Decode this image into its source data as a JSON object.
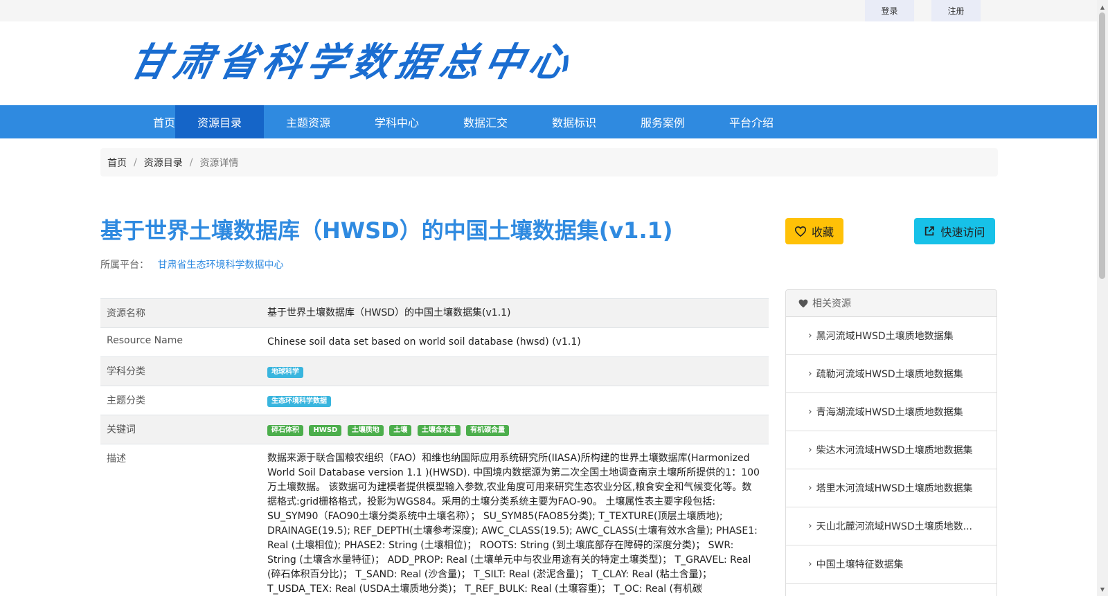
{
  "topbar": {
    "login_label": "登录",
    "register_label": "注册"
  },
  "logo": {
    "text": "甘肃省科学数据总中心"
  },
  "nav": {
    "items": [
      {
        "label": "首页"
      },
      {
        "label": "资源目录"
      },
      {
        "label": "主题资源"
      },
      {
        "label": "学科中心"
      },
      {
        "label": "数据汇交"
      },
      {
        "label": "数据标识"
      },
      {
        "label": "服务案例"
      },
      {
        "label": "平台介绍"
      }
    ],
    "active_index": 1
  },
  "breadcrumb": {
    "home": "首页",
    "catalog": "资源目录",
    "current": "资源详情"
  },
  "title": "基于世界土壤数据库（HWSD）的中国土壤数据集(v1.1)",
  "platform": {
    "label": "所属平台：",
    "value": "甘肃省生态环境科学数据中心"
  },
  "buttons": {
    "favorite": "收藏",
    "quick_visit": "快速访问"
  },
  "info": {
    "resource_name_key": "资源名称",
    "resource_name_val": "基于世界土壤数据库（HWSD）的中国土壤数据集(v1.1)",
    "resource_name_en_key": "Resource Name",
    "resource_name_en_val": "Chinese soil data set based on world soil database (hwsd) (v1.1)",
    "subject_key": "学科分类",
    "subject_tag": "地球科学",
    "theme_key": "主题分类",
    "theme_tag": "生态环境科学数据",
    "keywords_key": "关键词",
    "keywords": [
      "碎石体积",
      "HWSD",
      "土壤质地",
      "土壤",
      "土壤含水量",
      "有机碳含量"
    ],
    "desc_key": "描述",
    "desc_val": "数据来源于联合国粮农组织（FAO）和维也纳国际应用系统研究所(IIASA)所构建的世界土壤数据库(Harmonized World Soil Database version 1.1 )(HWSD). 中国境内数据源为第二次全国土地调查南京土壤所所提供的1：100万土壤数据。 该数据可为建模者提供模型输入参数,农业角度可用来研究生态农业分区,粮食安全和气候变化等。数据格式:grid栅格格式，投影为WGS84。采用的土壤分类系统主要为FAO-90。 土壤属性表主要字段包括: SU_SYM90（FAO90土壤分类系统中土壤名称）； SU_SYM85(FAO85分类); T_TEXTURE(顶层土壤质地); DRAINAGE(19.5); REF_DEPTH(土壤参考深度); AWC_CLASS(19.5); AWC_CLASS(土壤有效水含量); PHASE1: Real (土壤相位); PHASE2: String (土壤相位)； ROOTS: String (到土壤底部存在障碍的深度分类)； SWR: String (土壤含水量特征)； ADD_PROP: Real (土壤单元中与农业用途有关的特定土壤类型)； T_GRAVEL: Real (碎石体积百分比)； T_SAND: Real (沙含量)； T_SILT: Real (淤泥含量)； T_CLAY: Real (粘土含量)； T_USDA_TEX: Real (USDA土壤质地分类)； T_REF_BULK: Real (土壤容重)； T_OC: Real (有机碳"
  },
  "related": {
    "heading": "相关资源",
    "items": [
      "黑河流域HWSD土壤质地数据集",
      "疏勒河流域HWSD土壤质地数据集",
      "青海湖流域HWSD土壤质地数据集",
      "柴达木河流域HWSD土壤质地数据集",
      "塔里木河流域HWSD土壤质地数据集",
      "天山北麓河流域HWSD土壤质地数...",
      "中国土壤特征数据集"
    ]
  }
}
